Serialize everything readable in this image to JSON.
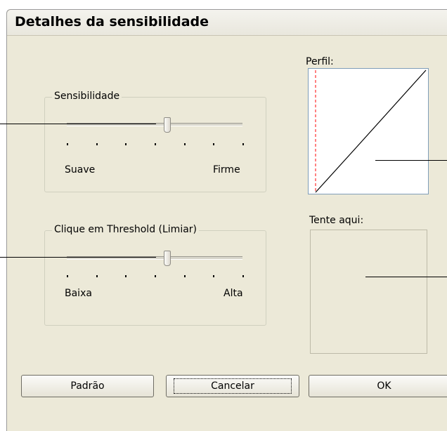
{
  "window": {
    "title": "Detalhes da sensibilidade"
  },
  "sensitivity": {
    "legend": "Sensibilidade",
    "min_label": "Suave",
    "max_label": "Firme",
    "level": 0.57
  },
  "threshold": {
    "legend": "Clique em Threshold (Limiar)",
    "min_label": "Baixa",
    "max_label": "Alta",
    "level": 0.57
  },
  "profile": {
    "label": "Perfil:",
    "colors": {
      "curve": "#000000",
      "marker": "#ff3030"
    }
  },
  "try_area": {
    "label": "Tente aqui:"
  },
  "buttons": {
    "default": "Padrão",
    "cancel": "Cancelar",
    "ok": "OK"
  }
}
